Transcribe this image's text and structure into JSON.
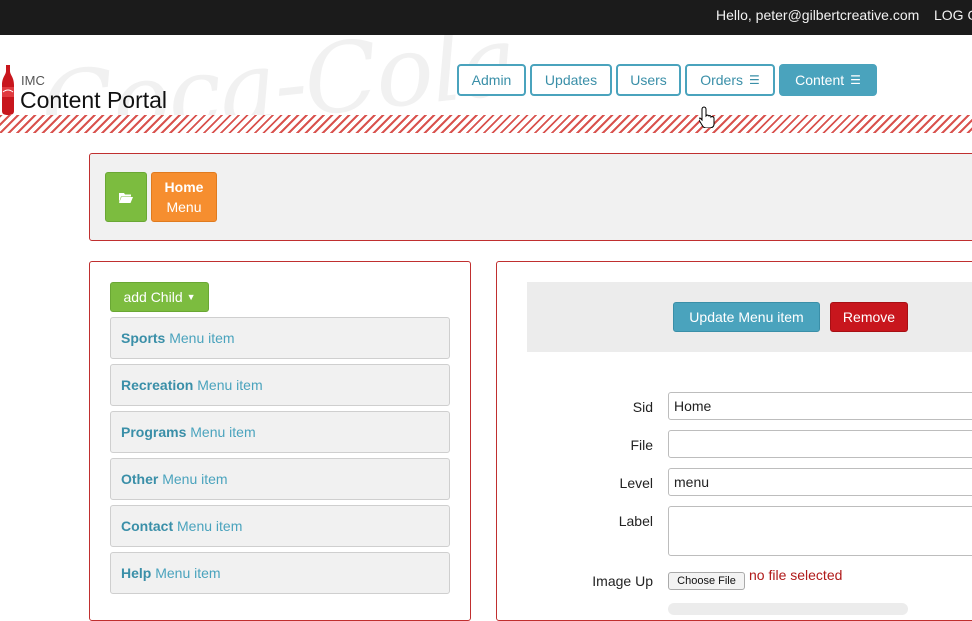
{
  "topbar": {
    "greeting": "Hello, peter@gilbertcreative.com",
    "logout": "LOG O"
  },
  "logo": {
    "small": "IMC",
    "title": "Content Portal",
    "watermark": "Coca-Cola"
  },
  "nav": [
    {
      "label": "Admin",
      "icon": ""
    },
    {
      "label": "Updates",
      "icon": ""
    },
    {
      "label": "Users",
      "icon": ""
    },
    {
      "label": "Orders",
      "icon": "list-icon"
    },
    {
      "label": "Content",
      "icon": "list-icon",
      "active": true
    }
  ],
  "breadcrumb": {
    "home_title": "Home",
    "home_sub": "Menu"
  },
  "left": {
    "add_child": "add Child",
    "items": [
      {
        "name": "Sports",
        "type": "Menu item"
      },
      {
        "name": "Recreation",
        "type": "Menu item"
      },
      {
        "name": "Programs",
        "type": "Menu item"
      },
      {
        "name": "Other",
        "type": "Menu item"
      },
      {
        "name": "Contact",
        "type": "Menu item"
      },
      {
        "name": "Help",
        "type": "Menu item"
      }
    ]
  },
  "right": {
    "update_label": "Update Menu item",
    "remove_label": "Remove",
    "fields": {
      "sid": {
        "label": "Sid",
        "value": "Home"
      },
      "file": {
        "label": "File",
        "value": ""
      },
      "level": {
        "label": "Level",
        "value": "menu"
      },
      "label": {
        "label": "Label",
        "value": ""
      },
      "image_up": {
        "label": "Image Up",
        "button": "Choose File",
        "status": "no file selected"
      }
    }
  },
  "colors": {
    "accent": "#4aa3bd",
    "green": "#7cbc3f",
    "orange": "#f68e2f",
    "danger": "#c8161d",
    "panel_border": "#c02f2f"
  }
}
